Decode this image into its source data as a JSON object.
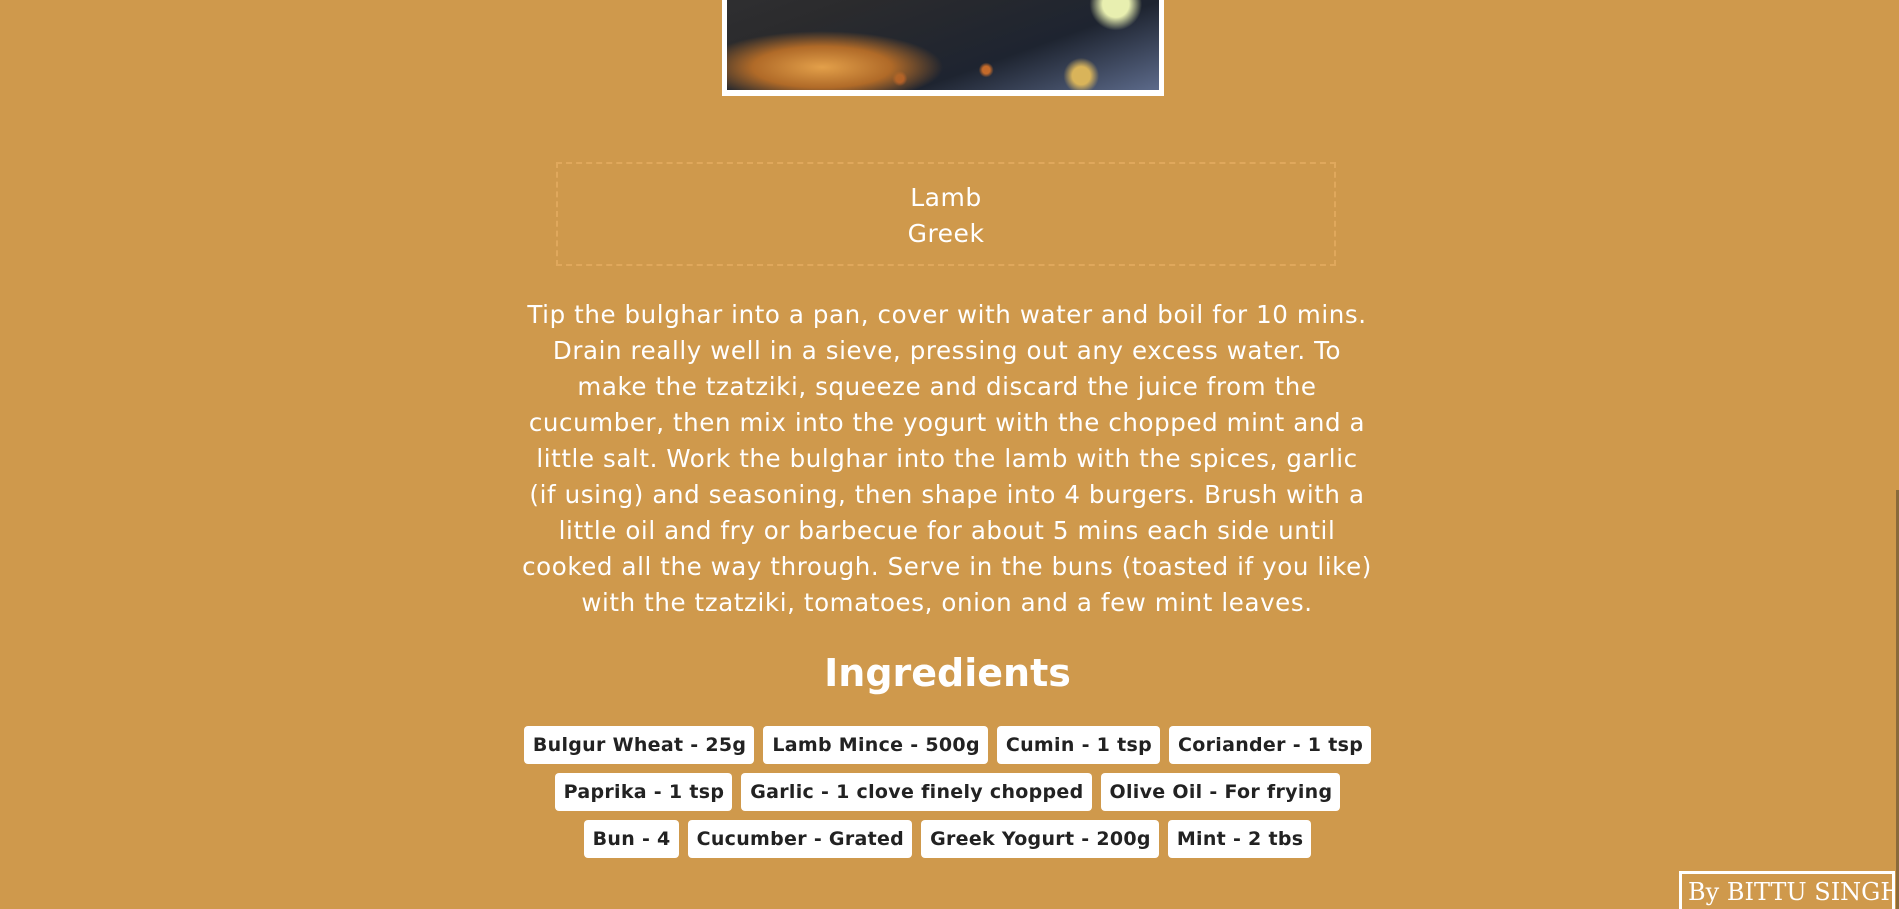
{
  "meal": {
    "image_alt": "Lamb burger meal photo",
    "category": "Lamb",
    "area": "Greek",
    "instructions": "Tip the bulghar into a pan, cover with water and boil for 10 mins. Drain really well in a sieve, pressing out any excess water. To make the tzatziki, squeeze and discard the juice from the cucumber, then mix into the yogurt with the chopped mint and a little salt. Work the bulghar into the lamb with the spices, garlic (if using) and seasoning, then shape into 4 burgers. Brush with a little oil and fry or barbecue for about 5 mins each side until cooked all the way through. Serve in the buns (toasted if you like) with the tzatziki, tomatoes, onion and a few mint leaves."
  },
  "ingredients": {
    "heading": "Ingredients",
    "items": [
      "Bulgur Wheat - 25g",
      "Lamb Mince - 500g",
      "Cumin - 1 tsp",
      "Coriander - 1 tsp",
      "Paprika - 1 tsp",
      "Garlic - 1 clove finely chopped",
      "Olive Oil - For frying",
      "Bun - 4",
      "Cucumber - Grated",
      "Greek Yogurt - 200g",
      "Mint - 2 tbs"
    ]
  },
  "footer": {
    "credit": "By BITTU SINGH"
  },
  "colors": {
    "background": "#cf994c",
    "text": "#ffffff",
    "chip_background": "#ffffff",
    "chip_text": "#222222",
    "tags_border": "#e0a85c"
  }
}
